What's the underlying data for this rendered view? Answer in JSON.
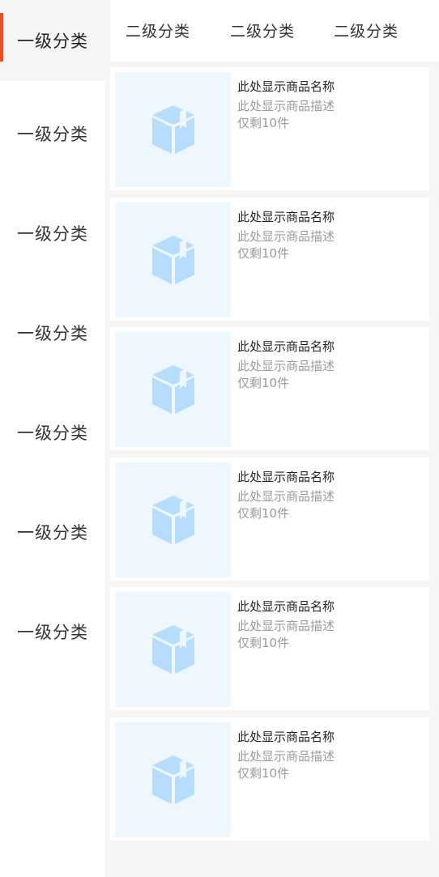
{
  "categories": {
    "primary": [
      {
        "label": "一级分类",
        "active": true
      },
      {
        "label": "一级分类"
      },
      {
        "label": "一级分类"
      },
      {
        "label": "一级分类"
      },
      {
        "label": "一级分类"
      },
      {
        "label": "一级分类"
      },
      {
        "label": "一级分类"
      }
    ],
    "secondary": [
      {
        "label": "二级分类"
      },
      {
        "label": "二级分类"
      },
      {
        "label": "二级分类"
      }
    ]
  },
  "products": [
    {
      "name": "此处显示商品名称",
      "desc": "此处显示商品描述",
      "stock": "仅剩10件"
    },
    {
      "name": "此处显示商品名称",
      "desc": "此处显示商品描述",
      "stock": "仅剩10件"
    },
    {
      "name": "此处显示商品名称",
      "desc": "此处显示商品描述",
      "stock": "仅剩10件"
    },
    {
      "name": "此处显示商品名称",
      "desc": "此处显示商品描述",
      "stock": "仅剩10件"
    },
    {
      "name": "此处显示商品名称",
      "desc": "此处显示商品描述",
      "stock": "仅剩10件"
    },
    {
      "name": "此处显示商品名称",
      "desc": "此处显示商品描述",
      "stock": "仅剩10件"
    }
  ],
  "theme": {
    "accent": "#ee4d2b",
    "placeholder_bg": "#eef6fe",
    "placeholder_icon": "#b6dcfe"
  },
  "icons": {
    "product_placeholder": "package-box-icon"
  }
}
